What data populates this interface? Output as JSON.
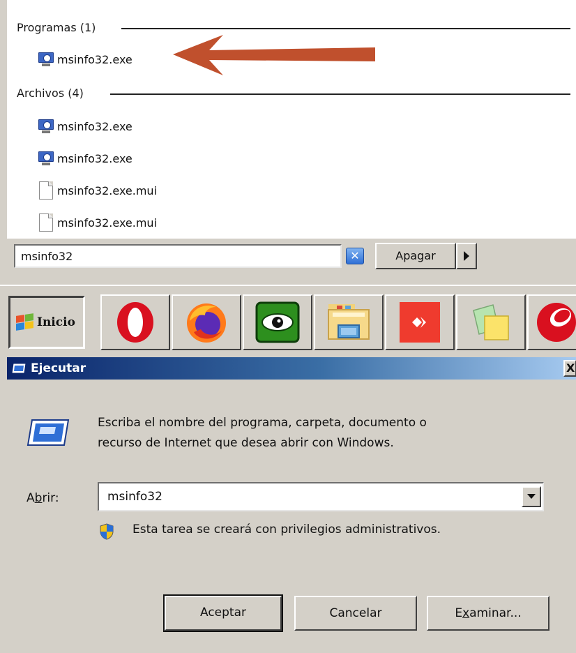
{
  "search_results": {
    "groups": [
      {
        "title": "Programas (1)",
        "items": [
          {
            "label": "msinfo32.exe",
            "icon": "system-info-icon"
          }
        ]
      },
      {
        "title": "Archivos (4)",
        "items": [
          {
            "label": "msinfo32.exe",
            "icon": "system-info-icon"
          },
          {
            "label": "msinfo32.exe",
            "icon": "system-info-icon"
          },
          {
            "label": "msinfo32.exe.mui",
            "icon": "file-icon"
          },
          {
            "label": "msinfo32.exe.mui",
            "icon": "file-icon"
          }
        ]
      }
    ],
    "annotation_arrow_color": "#c0502d"
  },
  "search_box": {
    "value": "msinfo32",
    "clear_icon": "close-icon"
  },
  "shutdown": {
    "label": "Apagar",
    "arrow_icon": "triangle-right-icon"
  },
  "taskbar": {
    "start_label": "Inicio",
    "start_icon": "windows-flag-icon",
    "apps": [
      {
        "icon": "opera-icon"
      },
      {
        "icon": "firefox-icon"
      },
      {
        "icon": "eye-icon"
      },
      {
        "icon": "file-explorer-icon"
      },
      {
        "icon": "anydesk-icon"
      },
      {
        "icon": "sticky-notes-icon"
      },
      {
        "icon": "opera-icon"
      }
    ]
  },
  "run_dialog": {
    "title": "Ejecutar",
    "close_label": "X",
    "description_line1": "Escriba el nombre del programa, carpeta, documento o",
    "description_line2": "recurso de Internet que desea abrir con Windows.",
    "open_label_pre": "A",
    "open_label_accel": "b",
    "open_label_post": "rir:",
    "open_value": "msinfo32",
    "admin_note": "Esta tarea se creará con privilegios administrativos.",
    "ok_label": "Aceptar",
    "cancel_label": "Cancelar",
    "browse_label_pre": "E",
    "browse_label_accel": "x",
    "browse_label_post": "aminar..."
  }
}
